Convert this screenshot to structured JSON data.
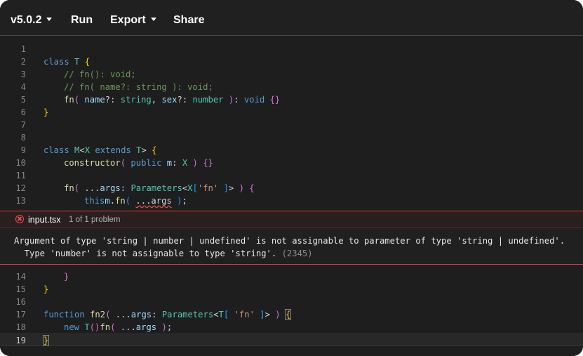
{
  "toolbar": {
    "version": "v5.0.2",
    "run": "Run",
    "export": "Export",
    "share": "Share"
  },
  "editor": {
    "ln": [
      "1",
      "2",
      "3",
      "4",
      "5",
      "6",
      "7",
      "8",
      "9",
      "10",
      "11",
      "12",
      "13",
      "14",
      "15",
      "16",
      "17",
      "18",
      "19"
    ],
    "l2": {
      "a": "class ",
      "b": "T ",
      "c": "{"
    },
    "l3": {
      "a": "// fn(): void;"
    },
    "l4": {
      "a": "// fn( name?: string ): void;"
    },
    "l5": {
      "a": "fn",
      "b": "( ",
      "c": "name",
      "d": "?: ",
      "e": "string",
      ",": ", ",
      "f": "sex",
      "g": "?: ",
      "h": "number",
      "i": " )",
      "j": ": ",
      "k": "void ",
      "l": "{}"
    },
    "l6": {
      "a": "}"
    },
    "l9": {
      "a": "class ",
      "b": "M",
      "c": "<",
      "d": "X ",
      "e": "extends ",
      "f": "T",
      "g": "> ",
      "h": "{"
    },
    "l10": {
      "a": "constructor",
      "b": "( ",
      "c": "public ",
      "d": "m",
      "e": ": ",
      "f": "X ",
      "g": ") ",
      "h": "{}"
    },
    "l12": {
      "a": "fn",
      "b": "( ",
      "c": "...",
      "d": "args",
      "e": ": ",
      "f": "Parameters",
      "g": "<",
      "h": "X",
      "i": "[",
      "j": "'fn'",
      "k": " ]",
      "l": "> ",
      "m": ") ",
      "n": "{"
    },
    "l13": {
      "a": "this",
      ".": ".",
      "b": "m",
      "c": ".",
      "d": "fn",
      "e": "( ",
      "f": "...args",
      " ": " ",
      "g": ")",
      ";": ";"
    },
    "l14": {
      "a": "}"
    },
    "l15": {
      "a": "}"
    },
    "l17": {
      "a": "function ",
      "b": "fn2",
      "c": "( ",
      "d": "...",
      "e": "args",
      "f": ": ",
      "g": "Parameters",
      "h": "<",
      "i": "T",
      "j": "[ ",
      "k": "'fn'",
      "l": " ]",
      "m": "> ",
      "n": ") ",
      "o": "{"
    },
    "l18": {
      "a": "new ",
      "b": "T",
      "c": "()",
      ".": ".",
      "d": "fn",
      "e": "( ",
      "f": "...",
      "g": "args",
      "h": " )",
      ";": ";"
    },
    "l19": {
      "a": "}"
    }
  },
  "problem": {
    "file": "input.tsx",
    "count": "1 of 1 problem",
    "line1": "Argument of type 'string | number | undefined' is not assignable to parameter of type 'string | undefined'.",
    "line2": "  Type 'number' is not assignable to type 'string'. ",
    "code": "(2345)"
  }
}
